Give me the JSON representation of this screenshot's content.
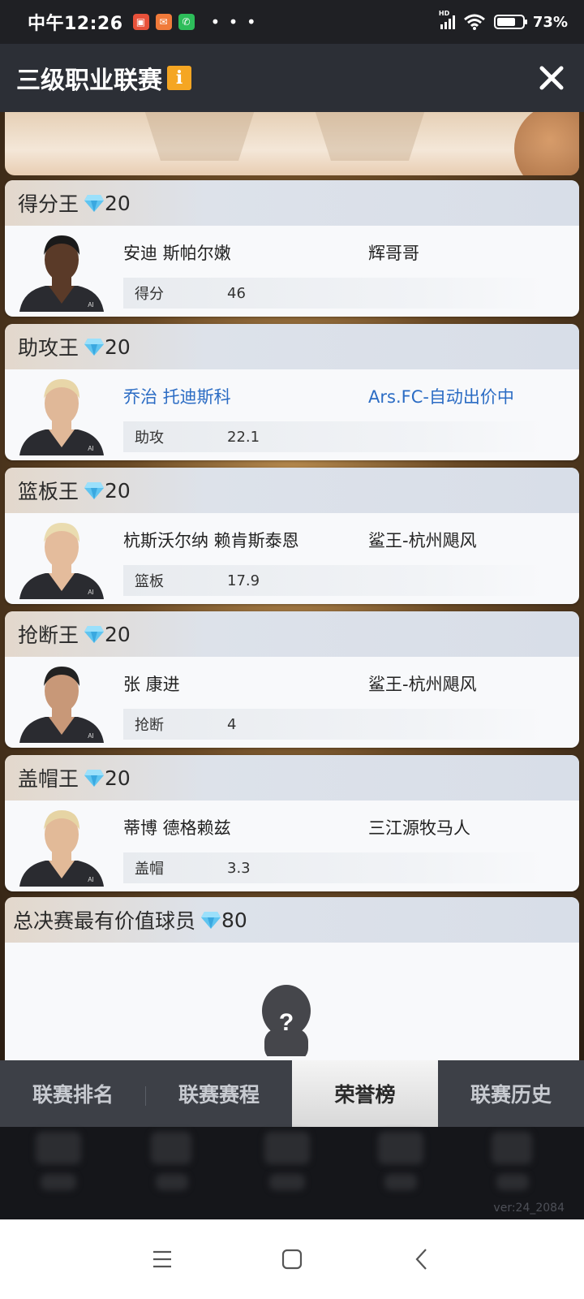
{
  "status_bar": {
    "time": "中午12:26",
    "dots": "• • •",
    "battery": "73%",
    "network": "HD"
  },
  "header": {
    "title": "三级职业联赛",
    "info_icon": "i"
  },
  "cards": [
    {
      "title": "得分王",
      "reward": "20",
      "player": "安迪 斯帕尔嫩",
      "team": "辉哥哥",
      "stat_label": "得分",
      "stat_value": "46",
      "highlight": false
    },
    {
      "title": "助攻王",
      "reward": "20",
      "player": "乔治 托迪斯科",
      "team": "Ars.FC-自动出价中",
      "stat_label": "助攻",
      "stat_value": "22.1",
      "highlight": true
    },
    {
      "title": "篮板王",
      "reward": "20",
      "player": "杭斯沃尔纳 赖肯斯泰恩",
      "team": "鲨王-杭州飓风",
      "stat_label": "篮板",
      "stat_value": "17.9",
      "highlight": false
    },
    {
      "title": "抢断王",
      "reward": "20",
      "player": "张 康进",
      "team": "鲨王-杭州飓风",
      "stat_label": "抢断",
      "stat_value": "4",
      "highlight": false
    },
    {
      "title": "盖帽王",
      "reward": "20",
      "player": "蒂博 德格赖兹",
      "team": "三江源牧马人",
      "stat_label": "盖帽",
      "stat_value": "3.3",
      "highlight": false
    }
  ],
  "mvp": {
    "title": "总决赛最有价值球员",
    "reward": "80"
  },
  "tabs": [
    {
      "label": "联赛排名",
      "active": false
    },
    {
      "label": "联赛赛程",
      "active": false
    },
    {
      "label": "荣誉榜",
      "active": true
    },
    {
      "label": "联赛历史",
      "active": false
    }
  ],
  "version": "ver:24_2084",
  "colors": {
    "highlight_blue": "#2b6cc4",
    "info_badge": "#f5a623",
    "header_bg": "#2c2f36",
    "tab_bg": "#3d4047"
  },
  "icons": [
    "gem-icon",
    "close-icon",
    "player-avatar",
    "mystery-player-icon",
    "menu-icon",
    "home-icon",
    "back-icon"
  ]
}
